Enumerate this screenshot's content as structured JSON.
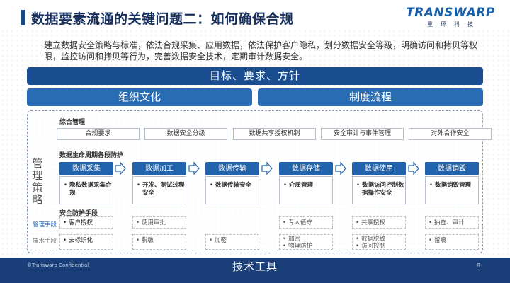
{
  "title": "数据要素流通的关键问题二：如何确保合规",
  "logo": {
    "main": "TRANSWARP",
    "sub": "星环科技"
  },
  "intro": "建立数据安全策略与标准，依法合规采集、应用数据，依法保护客户隐私，划分数据安全等级，明确访问和拷贝等权限，监控访问和拷贝等行为，完善数据安全技术，定期审计数据安全。",
  "bands": {
    "top": "目标、要求、方针",
    "left": "组织文化",
    "right": "制度流程"
  },
  "side_label": "管理策略",
  "comprehensive": {
    "heading": "综合管理",
    "items": [
      "合规要求",
      "数据安全分级",
      "数据共享授权机制",
      "安全审计与事件管理",
      "对外合作安全"
    ]
  },
  "lifecycle": {
    "heading": "数据生命周期各段防护",
    "stages": [
      {
        "name": "数据采集",
        "item": "隐私数据采集合规"
      },
      {
        "name": "数据加工",
        "item": "开发、测试过程安全"
      },
      {
        "name": "数据传输",
        "item": "数据传输安全"
      },
      {
        "name": "数据存储",
        "item": "介质管理"
      },
      {
        "name": "数据使用",
        "item": "数据访问控制数据操作安全"
      },
      {
        "name": "数据销毁",
        "item": "数据销毁管理"
      }
    ]
  },
  "protection": {
    "heading": "安全防护手段",
    "management_label": "管理手段",
    "technical_label": "技术手段",
    "management": [
      [
        "客户授权"
      ],
      [
        "使用审批"
      ],
      [],
      [
        "专人值守"
      ],
      [
        "共享授权"
      ],
      [
        "抽查、审计"
      ]
    ],
    "technical": [
      [
        "去标识化"
      ],
      [
        "脱敏"
      ],
      [
        "加密"
      ],
      [
        "加密",
        "物理防护"
      ],
      [
        "数据脱敏",
        "访问控制"
      ],
      [
        "留痕"
      ]
    ]
  },
  "footer": {
    "title": "技术工具",
    "confidential": "©Transwarp Confidential",
    "page": "8"
  },
  "colors": {
    "primary": "#1a4d8f",
    "secondary": "#2a6cb3",
    "footer": "#1a3e78",
    "title": "#17305e"
  }
}
